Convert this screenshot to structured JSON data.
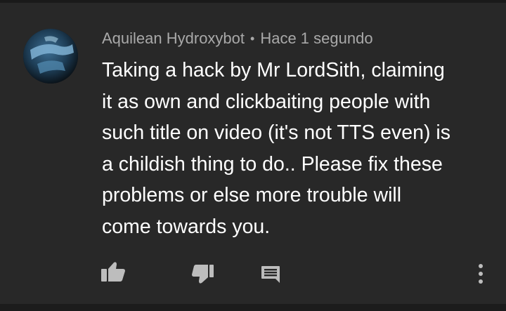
{
  "comment": {
    "author": "Aquilean Hydroxybot",
    "separator": "•",
    "timestamp": "Hace 1 segundo",
    "text": "Taking a hack by Mr LordSith, claiming\nit as own and clickbaiting people with\nsuch title on video (it's not TTS even) is\na childish thing to do.. Please fix these\nproblems or else more trouble will\ncome towards you.",
    "avatar": "avatar-icon"
  },
  "actions": {
    "like": "thumbs-up-icon",
    "dislike": "thumbs-down-icon",
    "reply": "reply-comment-icon",
    "more": "more-vertical-icon"
  },
  "colors": {
    "background": "#282828",
    "author": "#a9a9a9",
    "text": "#ffffff",
    "icons": "#bdbdbd"
  }
}
